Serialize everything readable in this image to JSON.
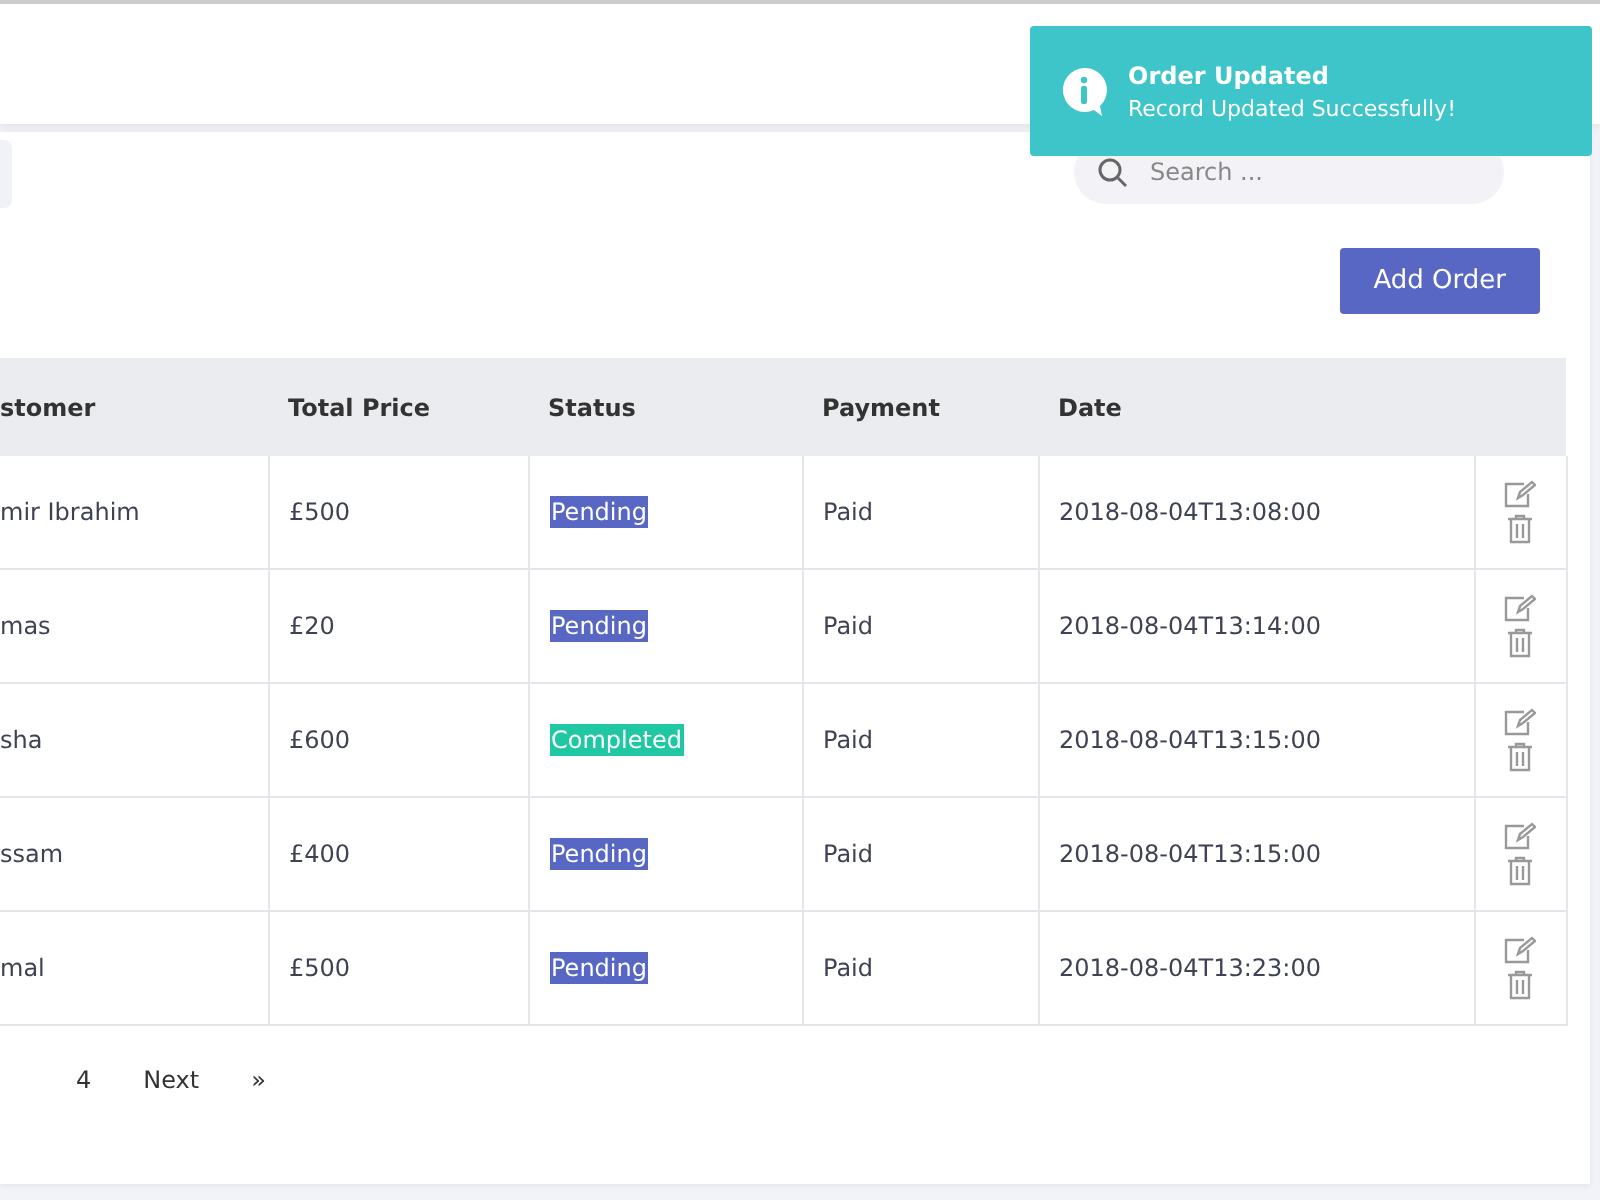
{
  "toast": {
    "title": "Order Updated",
    "message": "Record Updated Successfully!"
  },
  "search": {
    "placeholder": "Search ..."
  },
  "add_button": "Add Order",
  "table": {
    "columns": [
      "stomer",
      "Total Price",
      "Status",
      "Payment",
      "Date"
    ],
    "rows": [
      {
        "customer": "mir Ibrahim",
        "total": "£500",
        "status": "Pending",
        "kind": "pending",
        "payment": "Paid",
        "date": "2018-08-04T13:08:00"
      },
      {
        "customer": "mas",
        "total": "£20",
        "status": "Pending",
        "kind": "pending",
        "payment": "Paid",
        "date": "2018-08-04T13:14:00"
      },
      {
        "customer": "sha",
        "total": "£600",
        "status": "Completed",
        "kind": "completed",
        "payment": "Paid",
        "date": "2018-08-04T13:15:00"
      },
      {
        "customer": "ssam",
        "total": "£400",
        "status": "Pending",
        "kind": "pending",
        "payment": "Paid",
        "date": "2018-08-04T13:15:00"
      },
      {
        "customer": "mal",
        "total": "£500",
        "status": "Pending",
        "kind": "pending",
        "payment": "Paid",
        "date": "2018-08-04T13:23:00"
      }
    ]
  },
  "pagination": [
    "4",
    "Next",
    "»"
  ]
}
